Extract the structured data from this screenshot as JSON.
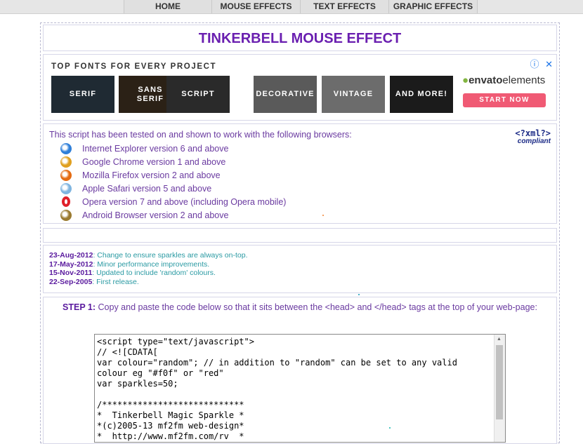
{
  "nav": {
    "items": [
      "HOME",
      "MOUSE EFFECTS",
      "TEXT EFFECTS",
      "GRAPHIC EFFECTS"
    ]
  },
  "page_title": "TINKERBELL MOUSE EFFECT",
  "ad": {
    "heading": "TOP FONTS FOR EVERY PROJECT",
    "tiles": [
      {
        "label": "SERIF",
        "bg": "#1f2a33"
      },
      {
        "label": "SANS\nSERIF",
        "bg": "#2b2116"
      },
      {
        "label": "SCRIPT",
        "bg": "#2a2a2a"
      },
      {
        "label": "DECORATIVE",
        "bg": "#5a5a5a"
      },
      {
        "label": "VINTAGE",
        "bg": "#6c6c6c"
      },
      {
        "label": "AND MORE!",
        "bg": "#1b1b1b"
      }
    ],
    "brand_name": "envato",
    "brand_suffix": "elements",
    "cta": "START NOW",
    "info_icon": "ⓘ",
    "close_icon": "✕"
  },
  "browsers": {
    "intro": "This script has been tested on and shown to work with the following browsers:",
    "items": [
      {
        "label": "Internet Explorer version 6 and above",
        "icon": "ie-icon",
        "color": "#2f7fd9"
      },
      {
        "label": "Google Chrome version 1 and above",
        "icon": "chrome-icon",
        "color": "#e0a020"
      },
      {
        "label": "Mozilla Firefox version 2 and above",
        "icon": "firefox-icon",
        "color": "#e46b12"
      },
      {
        "label": "Apple Safari version 5 and above",
        "icon": "safari-icon",
        "color": "#7fb5e0"
      },
      {
        "label": "Opera version 7 and above (including Opera mobile)",
        "icon": "opera-icon",
        "color": "#e0202a"
      },
      {
        "label": "Android Browser version 2 and above",
        "icon": "android-icon",
        "color": "#9a7a30"
      }
    ],
    "badge_line1": "<?xml?>",
    "badge_line2": "compliant"
  },
  "changelog": [
    {
      "date": "23-Aug-2012",
      "text": ": Change to ensure sparkles are always on-top."
    },
    {
      "date": "17-May-2012",
      "text": ": Minor performance improvements."
    },
    {
      "date": "15-Nov-2011",
      "text": ": Updated to include 'random' colours."
    },
    {
      "date": "22-Sep-2005",
      "text": ": First release."
    }
  ],
  "step": {
    "label": "STEP 1:",
    "text": " Copy and paste the code below so that it sits between the <head> and </head> tags at the top of your web-page:"
  },
  "code": "<script type=\"text/javascript\">\n// <![CDATA[\nvar colour=\"random\"; // in addition to \"random\" can be set to any valid\ncolour eg \"#f0f\" or \"red\"\nvar sparkles=50;\n\n/****************************\n*  Tinkerbell Magic Sparkle *\n*(c)2005-13 mf2fm web-design*\n*  http://www.mf2fm.com/rv  *"
}
